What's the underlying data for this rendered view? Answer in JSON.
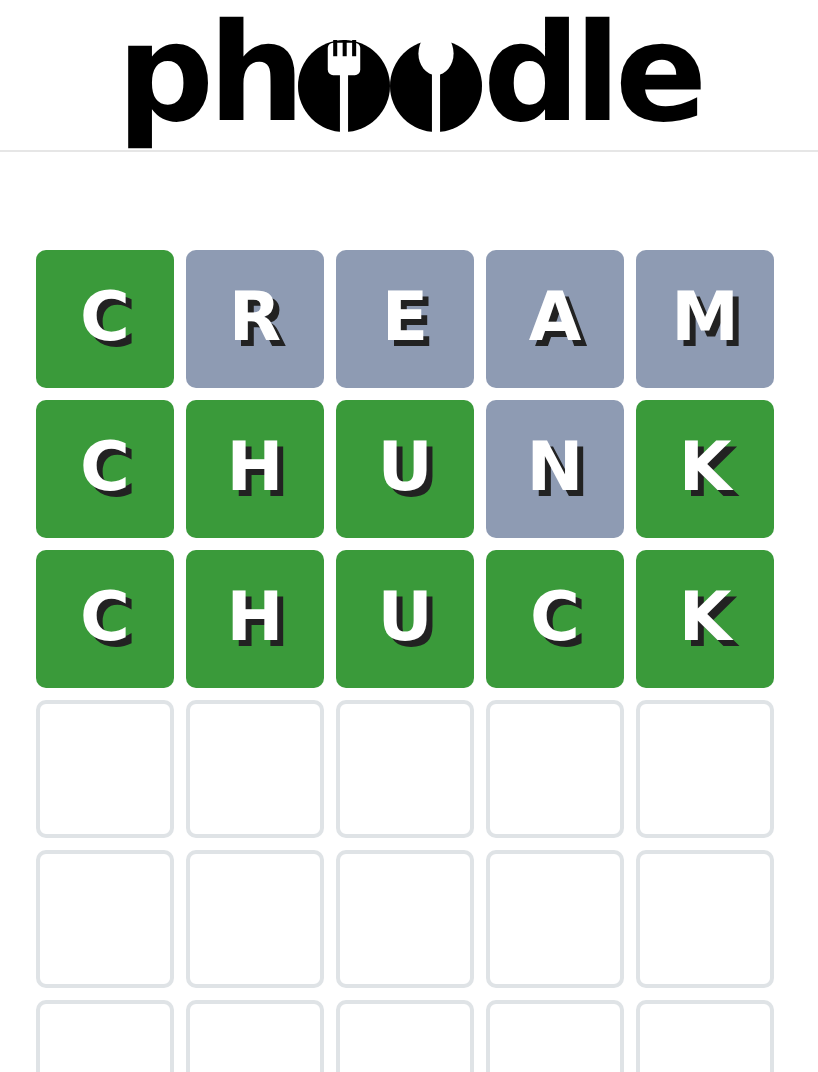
{
  "logo": {
    "start": "ph",
    "end": "dle"
  },
  "board": [
    [
      {
        "kind": "filled",
        "letter": "C",
        "color": "#3a9a3a"
      },
      {
        "kind": "filled",
        "letter": "R",
        "color": "#8e9bb3"
      },
      {
        "kind": "filled",
        "letter": "E",
        "color": "#8e9bb3"
      },
      {
        "kind": "filled",
        "letter": "A",
        "color": "#8e9bb3"
      },
      {
        "kind": "filled",
        "letter": "M",
        "color": "#8e9bb3"
      }
    ],
    [
      {
        "kind": "filled",
        "letter": "C",
        "color": "#3a9a3a"
      },
      {
        "kind": "filled",
        "letter": "H",
        "color": "#3a9a3a"
      },
      {
        "kind": "filled",
        "letter": "U",
        "color": "#3a9a3a"
      },
      {
        "kind": "filled",
        "letter": "N",
        "color": "#8e9bb3"
      },
      {
        "kind": "filled",
        "letter": "K",
        "color": "#3a9a3a"
      }
    ],
    [
      {
        "kind": "filled",
        "letter": "C",
        "color": "#3a9a3a"
      },
      {
        "kind": "filled",
        "letter": "H",
        "color": "#3a9a3a"
      },
      {
        "kind": "filled",
        "letter": "U",
        "color": "#3a9a3a"
      },
      {
        "kind": "filled",
        "letter": "C",
        "color": "#3a9a3a"
      },
      {
        "kind": "filled",
        "letter": "K",
        "color": "#3a9a3a"
      }
    ],
    [
      {
        "kind": "empty"
      },
      {
        "kind": "empty"
      },
      {
        "kind": "empty"
      },
      {
        "kind": "empty"
      },
      {
        "kind": "empty"
      }
    ],
    [
      {
        "kind": "empty"
      },
      {
        "kind": "empty"
      },
      {
        "kind": "empty"
      },
      {
        "kind": "empty"
      },
      {
        "kind": "empty"
      }
    ],
    [
      {
        "kind": "empty"
      },
      {
        "kind": "empty"
      },
      {
        "kind": "empty"
      },
      {
        "kind": "empty"
      },
      {
        "kind": "empty"
      }
    ]
  ]
}
